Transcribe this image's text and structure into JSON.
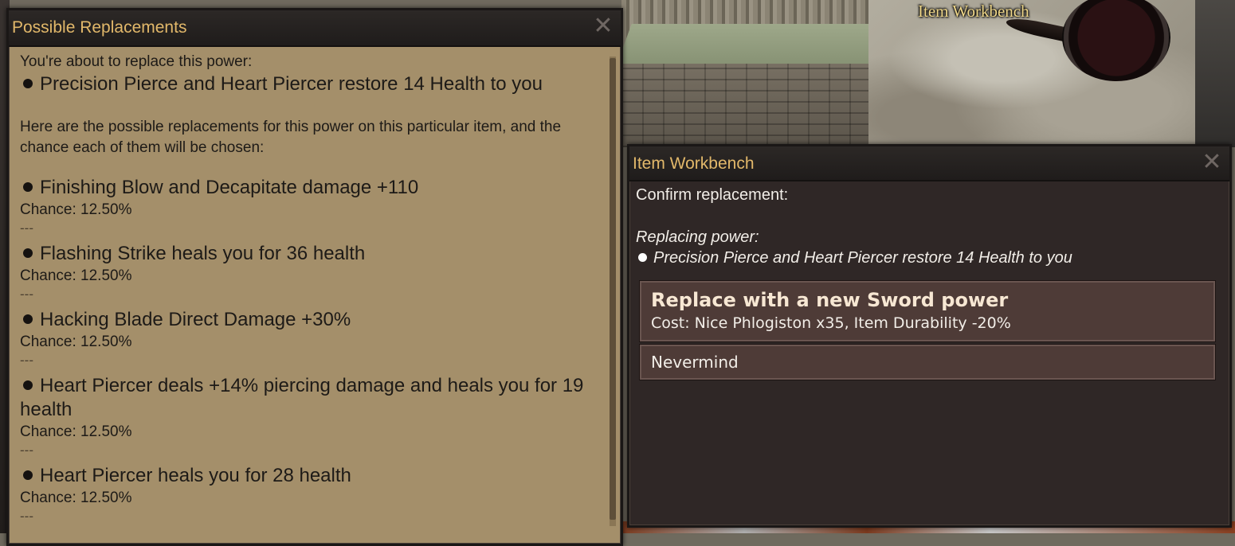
{
  "world": {
    "label": "Item Workbench"
  },
  "left_panel": {
    "title": "Possible Replacements",
    "intro": "You're about to replace this power:",
    "current_power": "Precision Pierce and Heart Piercer restore 14 Health to you",
    "description": "Here are the possible replacements for this power on this particular item, and the chance each of them will be chosen:",
    "separator": "---",
    "replacements": [
      {
        "name": "Finishing Blow and Decapitate damage +110",
        "chance": "Chance: 12.50%"
      },
      {
        "name": "Flashing Strike heals you for 36 health",
        "chance": "Chance: 12.50%"
      },
      {
        "name": "Hacking Blade Direct Damage +30%",
        "chance": "Chance: 12.50%"
      },
      {
        "name": "Heart Piercer deals +14% piercing damage and heals you for 19 health",
        "chance": "Chance: 12.50%"
      },
      {
        "name": "Heart Piercer heals you for 28 health",
        "chance": "Chance: 12.50%"
      }
    ]
  },
  "right_panel": {
    "title": "Item Workbench",
    "confirm_text": "Confirm replacement:",
    "replacing_label": "Replacing power:",
    "replacing_power": "Precision Pierce and Heart Piercer restore 14 Health to you",
    "option_replace": {
      "title": "Replace with a new Sword power",
      "cost": "Cost: Nice Phlogiston x35, Item Durability -20%"
    },
    "option_cancel": "Nevermind"
  },
  "icons": {
    "close": "close-icon",
    "bullet": "bullet-icon"
  },
  "colors": {
    "parchment": "#a48f6a",
    "title_gold": "#e2b86a",
    "dark_panel": "#2f2726",
    "button": "#4e3b37"
  }
}
